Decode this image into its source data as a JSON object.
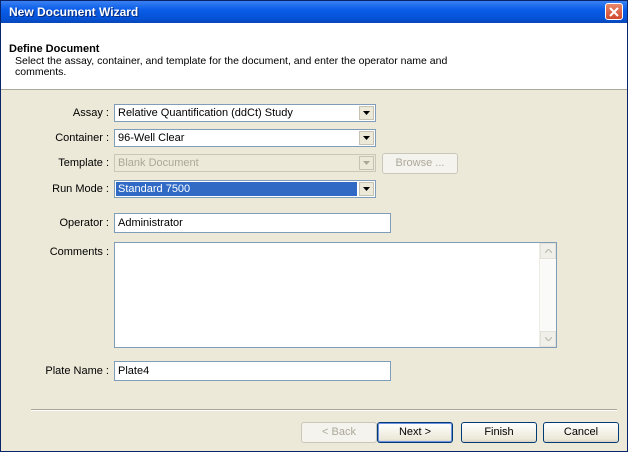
{
  "window": {
    "title": "New Document Wizard"
  },
  "header": {
    "title": "Define Document",
    "description": "Select the assay, container, and template for the document, and enter the operator name and comments."
  },
  "form": {
    "assay": {
      "label": "Assay :",
      "value": "Relative Quantification (ddCt) Study"
    },
    "container": {
      "label": "Container :",
      "value": "96-Well Clear"
    },
    "template": {
      "label": "Template :",
      "value": "Blank Document",
      "browse_label": "Browse ..."
    },
    "run_mode": {
      "label": "Run Mode :",
      "value": "Standard 7500"
    },
    "operator": {
      "label": "Operator :",
      "value": "Administrator"
    },
    "comments": {
      "label": "Comments :",
      "value": ""
    },
    "plate_name": {
      "label": "Plate Name :",
      "value": "Plate4"
    }
  },
  "buttons": {
    "back": "< Back",
    "next": "Next >",
    "finish": "Finish",
    "cancel": "Cancel"
  },
  "colors": {
    "title_bar": "#0a5ce8",
    "selection": "#316ac5",
    "dialog_bg": "#ece9d8"
  }
}
